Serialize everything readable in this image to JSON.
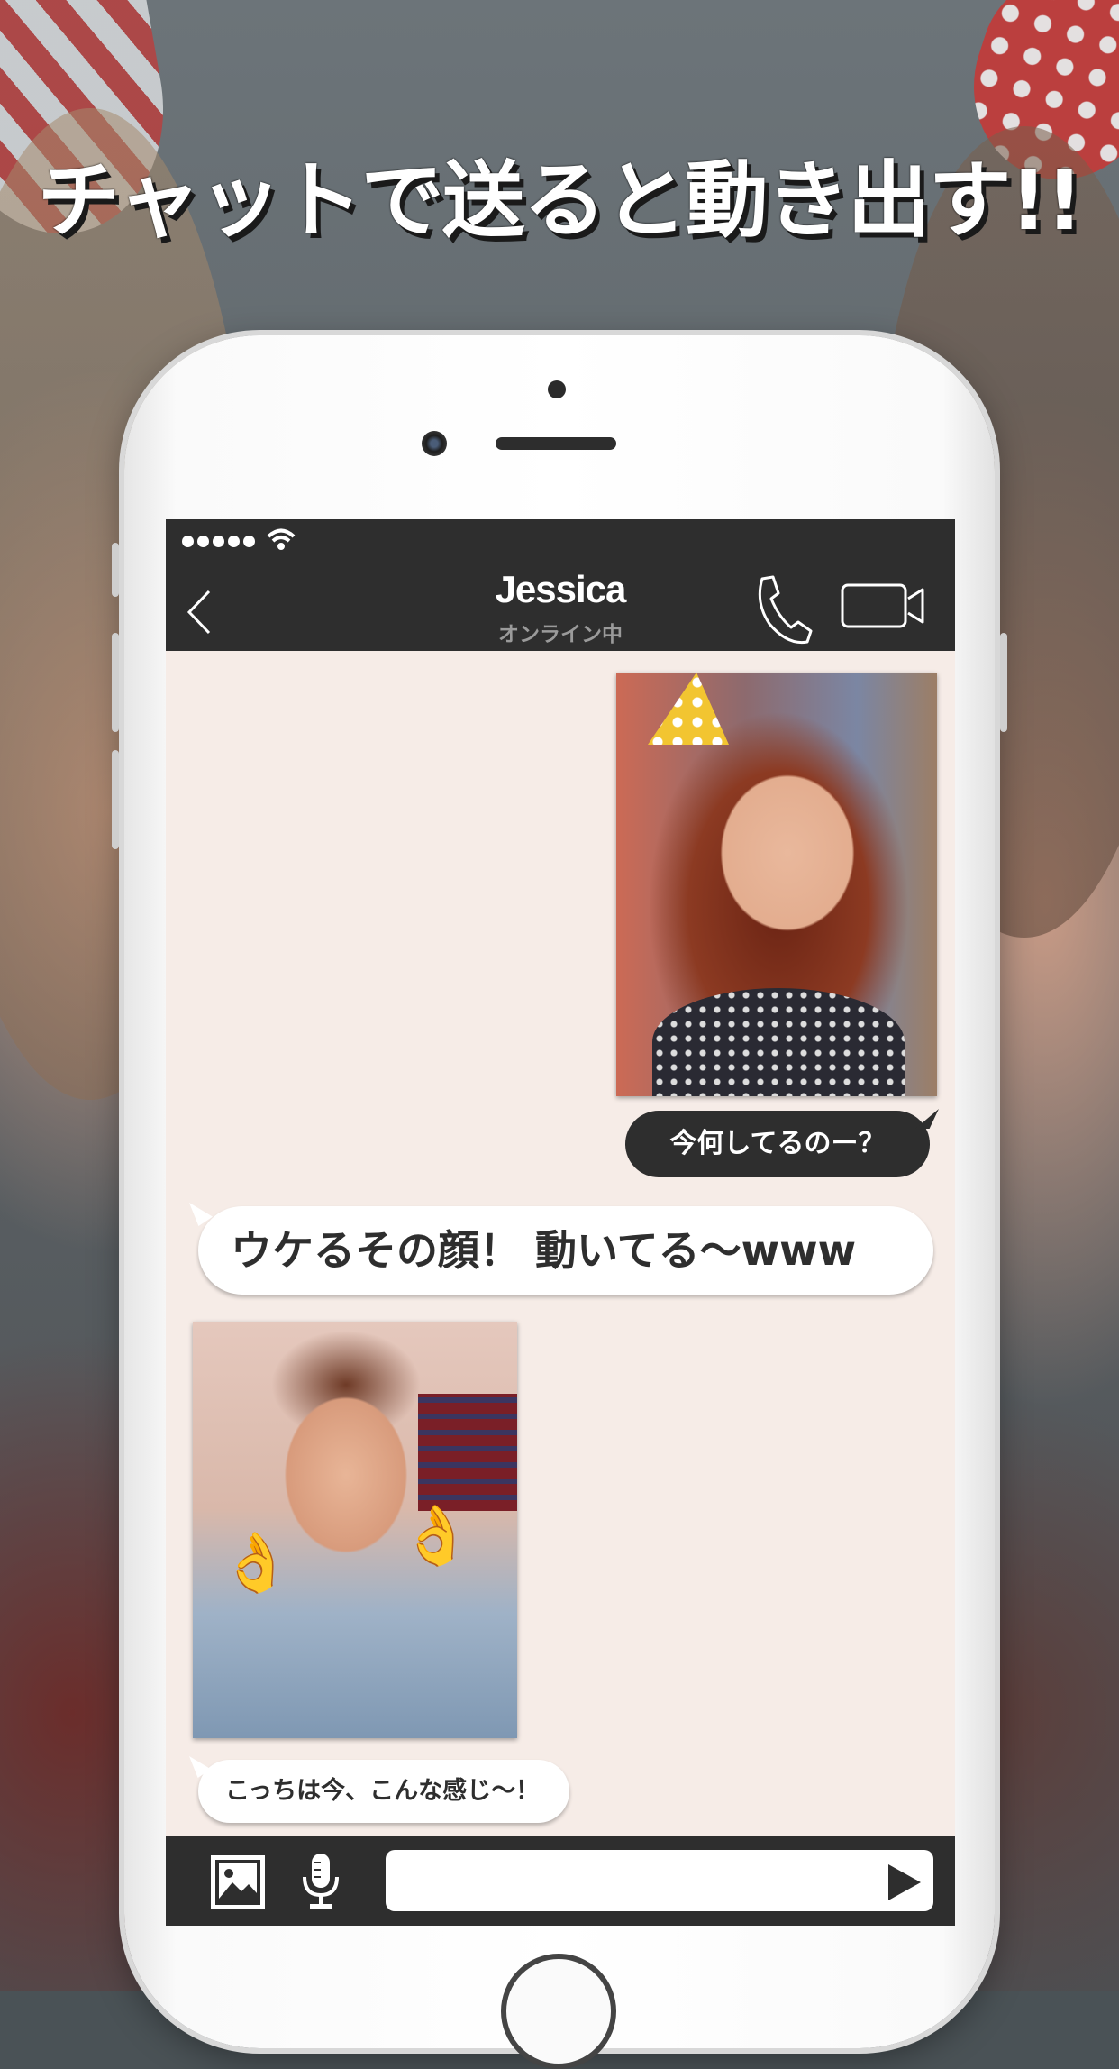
{
  "headline": "チャットで送ると動き出す!!",
  "status_bar": {
    "signal_dots": 5
  },
  "nav": {
    "contact_name": "Jessica",
    "contact_status": "オンライン中",
    "back_icon": "chevron-left-icon",
    "call_icon": "phone-icon",
    "video_icon": "video-camera-icon"
  },
  "messages": [
    {
      "type": "photo",
      "side": "right"
    },
    {
      "type": "text",
      "side": "right",
      "text": "今何してるのー？"
    },
    {
      "type": "text",
      "side": "left",
      "text": "ウケるその顔！ 動いてる〜www"
    },
    {
      "type": "photo",
      "side": "left"
    },
    {
      "type": "text",
      "side": "left",
      "text": "こっちは今、こんな感じ〜！"
    }
  ],
  "input_bar": {
    "image_icon": "image-icon",
    "mic_icon": "microphone-icon",
    "message_value": "",
    "send_icon": "send-play-icon"
  },
  "colors": {
    "dark_bar": "#2e2e2e",
    "chat_background": "#f6ece7",
    "bubble_incoming": "#ffffff",
    "bubble_outgoing": "#2e2e2e"
  }
}
